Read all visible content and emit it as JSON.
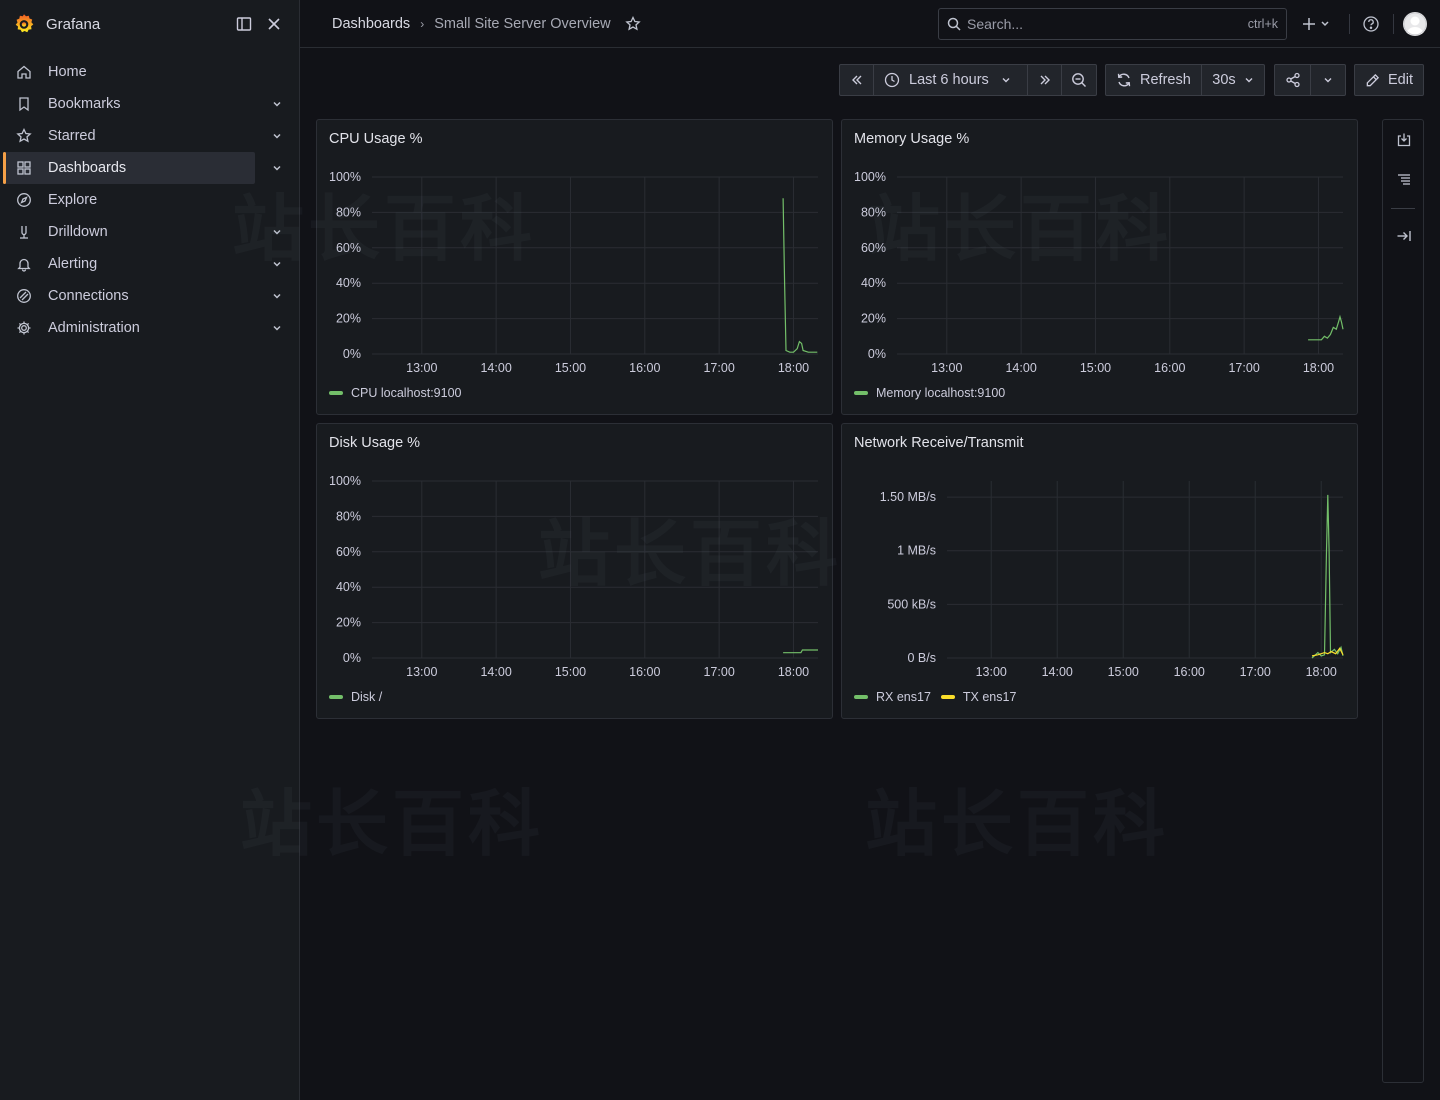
{
  "app": {
    "name": "Grafana"
  },
  "sidebar": {
    "items": [
      {
        "label": "Home",
        "icon": "home-icon",
        "has_chevron": false,
        "active": false
      },
      {
        "label": "Bookmarks",
        "icon": "bookmark-icon",
        "has_chevron": true,
        "active": false
      },
      {
        "label": "Starred",
        "icon": "star-icon",
        "has_chevron": true,
        "active": false
      },
      {
        "label": "Dashboards",
        "icon": "apps-icon",
        "has_chevron": true,
        "active": true
      },
      {
        "label": "Explore",
        "icon": "compass-icon",
        "has_chevron": false,
        "active": false
      },
      {
        "label": "Drilldown",
        "icon": "drilldown-icon",
        "has_chevron": true,
        "active": false
      },
      {
        "label": "Alerting",
        "icon": "bell-icon",
        "has_chevron": true,
        "active": false
      },
      {
        "label": "Connections",
        "icon": "connections-icon",
        "has_chevron": true,
        "active": false
      },
      {
        "label": "Administration",
        "icon": "cog-icon",
        "has_chevron": true,
        "active": false
      }
    ]
  },
  "topbar": {
    "breadcrumb_root": "Dashboards",
    "breadcrumb_sep": "›",
    "breadcrumb_current": "Small Site Server Overview",
    "search_placeholder": "Search...",
    "search_shortcut": "ctrl+k"
  },
  "toolbar": {
    "time_range": "Last 6 hours",
    "refresh_label": "Refresh",
    "refresh_interval": "30s",
    "edit_label": "Edit"
  },
  "watermark": "站长百科",
  "colors": {
    "green": "#73bf69",
    "yellow": "#fade2a",
    "accent": "#f5a047"
  },
  "panels": [
    {
      "title": "CPU Usage %",
      "legend": [
        {
          "label": "CPU localhost:9100",
          "color": "#73bf69"
        }
      ]
    },
    {
      "title": "Memory Usage %",
      "legend": [
        {
          "label": "Memory localhost:9100",
          "color": "#73bf69"
        }
      ]
    },
    {
      "title": "Disk Usage %",
      "legend": [
        {
          "label": "Disk /",
          "color": "#73bf69"
        }
      ]
    },
    {
      "title": "Network Receive/Transmit",
      "legend": [
        {
          "label": "RX ens17",
          "color": "#73bf69"
        },
        {
          "label": "TX ens17",
          "color": "#fade2a"
        }
      ]
    }
  ],
  "chart_data": [
    {
      "type": "line",
      "title": "CPU Usage %",
      "ylim": [
        0,
        100
      ],
      "y_ticks": [
        "0%",
        "20%",
        "40%",
        "60%",
        "80%",
        "100%"
      ],
      "x_ticks": [
        "13:00",
        "14:00",
        "15:00",
        "16:00",
        "17:00",
        "18:00"
      ],
      "x_range_hours": [
        12.33,
        18.33
      ],
      "series": [
        {
          "name": "CPU localhost:9100",
          "color": "#73bf69",
          "points": [
            [
              17.86,
              88
            ],
            [
              17.88,
              40
            ],
            [
              17.9,
              2
            ],
            [
              17.95,
              1
            ],
            [
              18.0,
              1
            ],
            [
              18.05,
              3
            ],
            [
              18.08,
              7
            ],
            [
              18.11,
              6
            ],
            [
              18.13,
              2
            ],
            [
              18.2,
              1
            ],
            [
              18.32,
              1
            ]
          ]
        }
      ]
    },
    {
      "type": "line",
      "title": "Memory Usage %",
      "ylim": [
        0,
        100
      ],
      "y_ticks": [
        "0%",
        "20%",
        "40%",
        "60%",
        "80%",
        "100%"
      ],
      "x_ticks": [
        "13:00",
        "14:00",
        "15:00",
        "16:00",
        "17:00",
        "18:00"
      ],
      "x_range_hours": [
        12.33,
        18.33
      ],
      "series": [
        {
          "name": "Memory localhost:9100",
          "color": "#73bf69",
          "points": [
            [
              17.86,
              8
            ],
            [
              17.95,
              8
            ],
            [
              18.04,
              8
            ],
            [
              18.08,
              10
            ],
            [
              18.12,
              9
            ],
            [
              18.16,
              11
            ],
            [
              18.2,
              15
            ],
            [
              18.24,
              14
            ],
            [
              18.27,
              18
            ],
            [
              18.29,
              21
            ],
            [
              18.31,
              18
            ],
            [
              18.33,
              14
            ]
          ]
        }
      ]
    },
    {
      "type": "line",
      "title": "Disk Usage %",
      "ylim": [
        0,
        100
      ],
      "y_ticks": [
        "0%",
        "20%",
        "40%",
        "60%",
        "80%",
        "100%"
      ],
      "x_ticks": [
        "13:00",
        "14:00",
        "15:00",
        "16:00",
        "17:00",
        "18:00"
      ],
      "x_range_hours": [
        12.33,
        18.33
      ],
      "series": [
        {
          "name": "Disk /",
          "color": "#73bf69",
          "points": [
            [
              17.86,
              3
            ],
            [
              17.97,
              3
            ],
            [
              18.1,
              3
            ],
            [
              18.12,
              4.5
            ],
            [
              18.33,
              4.5
            ]
          ]
        }
      ]
    },
    {
      "type": "line",
      "title": "Network Receive/Transmit",
      "ylim": [
        0,
        1.65
      ],
      "y_unit": "MB/s",
      "y_ticks": [
        "0 B/s",
        "500 kB/s",
        "1 MB/s",
        "1.50 MB/s"
      ],
      "y_tick_values": [
        0,
        0.5,
        1.0,
        1.5
      ],
      "x_ticks": [
        "13:00",
        "14:00",
        "15:00",
        "16:00",
        "17:00",
        "18:00"
      ],
      "x_range_hours": [
        12.33,
        18.33
      ],
      "series": [
        {
          "name": "RX ens17",
          "color": "#73bf69",
          "points": [
            [
              17.86,
              0
            ],
            [
              17.95,
              0.05
            ],
            [
              18.0,
              0.02
            ],
            [
              18.05,
              0.03
            ],
            [
              18.08,
              1.0
            ],
            [
              18.1,
              1.52
            ],
            [
              18.12,
              1.0
            ],
            [
              18.14,
              0.05
            ],
            [
              18.2,
              0.08
            ],
            [
              18.25,
              0.04
            ],
            [
              18.3,
              0.1
            ],
            [
              18.33,
              0.02
            ]
          ]
        },
        {
          "name": "TX ens17",
          "color": "#fade2a",
          "points": [
            [
              17.86,
              0.02
            ],
            [
              17.95,
              0.03
            ],
            [
              18.05,
              0.05
            ],
            [
              18.1,
              0.04
            ],
            [
              18.15,
              0.06
            ],
            [
              18.22,
              0.04
            ],
            [
              18.28,
              0.09
            ],
            [
              18.33,
              0.03
            ]
          ]
        }
      ]
    }
  ]
}
